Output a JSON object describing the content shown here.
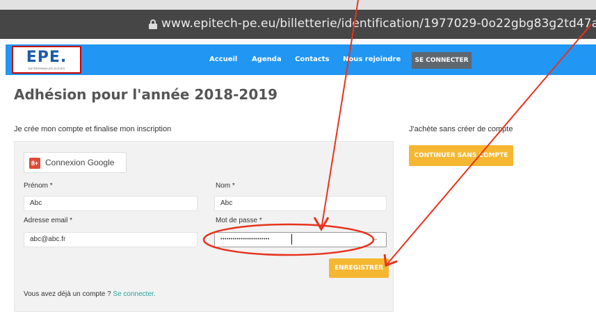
{
  "browser": {
    "url": "www.epitech-pe.eu/billetterie/identification/1977029-0o22gbg83g2td47a"
  },
  "nav": {
    "logo_text": "EPE.",
    "logo_subtitle": "ENTREPRENEURS ELEVES",
    "links": [
      "Accueil",
      "Agenda",
      "Contacts",
      "Nous rejoindre"
    ],
    "login_button": "SE CONNECTER",
    "bg_color": "#2196f3"
  },
  "page": {
    "title": "Adhésion pour l'année 2018-2019",
    "create_account_subtitle": "Je crée mon compte et finalise mon inscription",
    "no_account_subtitle": "J'achète sans créer de compte",
    "continue_button": "CONTINUER SANS COMPTE"
  },
  "form": {
    "google_button": "Connexion Google",
    "google_icon_glyph": "8+",
    "prenom_label": "Prénom *",
    "prenom_value": "Abc",
    "nom_label": "Nom *",
    "nom_value": "Abc",
    "email_label": "Adresse email *",
    "email_value": "abc@abc.fr",
    "password_label": "Mot de passe *",
    "password_value": "••••••••••••••••••••••••",
    "dropdown_glyph": "⌄",
    "save_button": "ENREGISTRER",
    "already_text": "Vous avez déjà un compte ?",
    "login_link": "Se connecter.",
    "accent_color": "#f5b731"
  },
  "annotations": {
    "color": "#e8321c",
    "items": [
      "red-arrow",
      "red-ellipse"
    ]
  }
}
